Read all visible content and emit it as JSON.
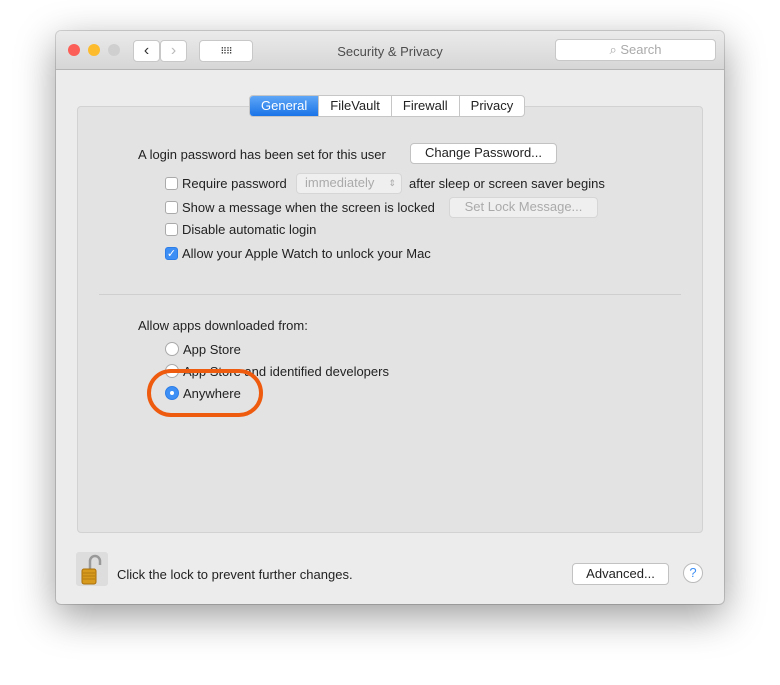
{
  "window": {
    "title": "Security & Privacy",
    "search_placeholder": "Search"
  },
  "tabs": [
    {
      "label": "General",
      "selected": true
    },
    {
      "label": "FileVault"
    },
    {
      "label": "Firewall"
    },
    {
      "label": "Privacy"
    }
  ],
  "general": {
    "login_text": "A login password has been set for this user",
    "change_password": "Change Password...",
    "require_password": {
      "label": "Require password",
      "checked": false,
      "select_value": "immediately",
      "suffix": "after sleep or screen saver begins"
    },
    "show_message": {
      "label": "Show a message when the screen is locked",
      "checked": false,
      "button": "Set Lock Message..."
    },
    "disable_login": {
      "label": "Disable automatic login",
      "checked": false
    },
    "apple_watch": {
      "label": "Allow your Apple Watch to unlock your Mac",
      "checked": true
    },
    "allow_apps_label": "Allow apps downloaded from:",
    "radio_options": [
      {
        "label": "App Store",
        "selected": false
      },
      {
        "label": "App Store and identified developers",
        "selected": false
      },
      {
        "label": "Anywhere",
        "selected": true
      }
    ]
  },
  "footer": {
    "lock_text": "Click the lock to prevent further changes.",
    "advanced": "Advanced...",
    "help": "?"
  },
  "colors": {
    "accent": "#1a74e8",
    "highlight_annotation": "#ee5a0e"
  }
}
